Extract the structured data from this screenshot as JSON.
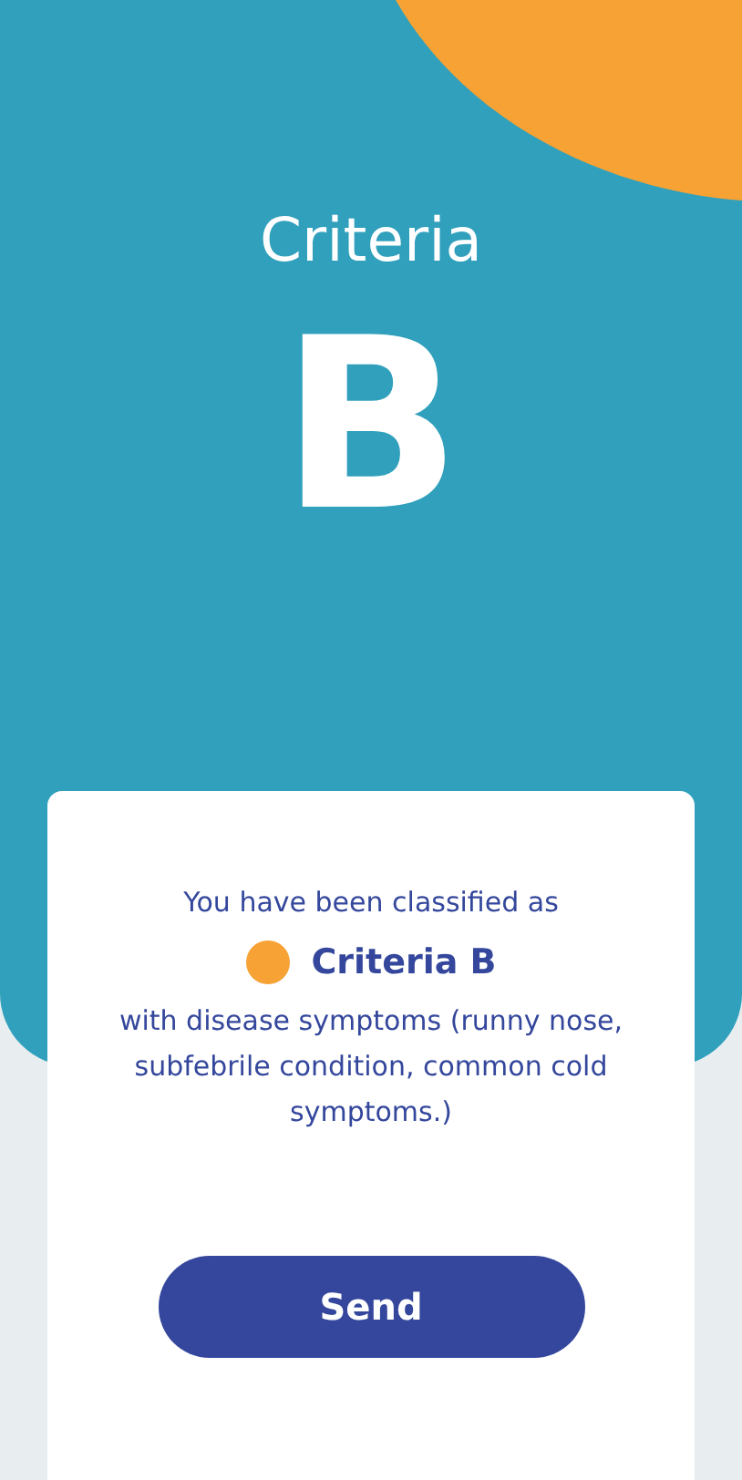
{
  "header": {
    "title": "Criteria",
    "grade": "B"
  },
  "card": {
    "intro": "You have been classified as",
    "classification": {
      "label": "Criteria B",
      "color": "#f7a234"
    },
    "description": "with disease symptoms (runny nose, subfebrile condition, common cold symptoms.)"
  },
  "button": {
    "label": "Send"
  }
}
